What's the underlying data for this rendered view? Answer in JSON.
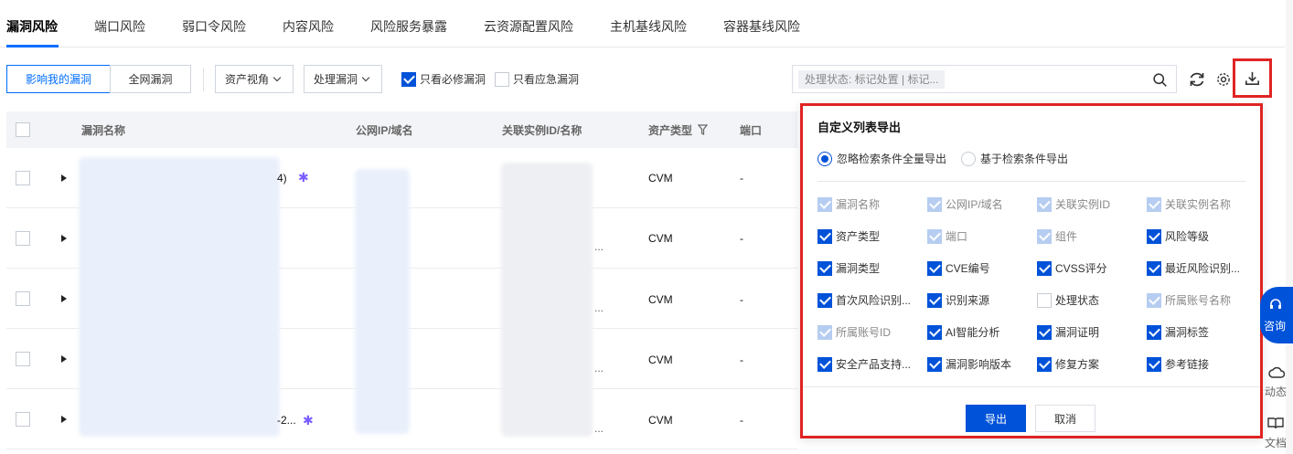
{
  "tabs": [
    "漏洞风险",
    "端口风险",
    "弱口令风险",
    "内容风险",
    "风险服务暴露",
    "云资源配置风险",
    "主机基线风险",
    "容器基线风险"
  ],
  "toolbar": {
    "seg_mine": "影响我的漏洞",
    "seg_all": "全网漏洞",
    "asset_view": "资产视角",
    "handle": "处理漏洞",
    "must_fix": "只看必修漏洞",
    "emergency": "只看应急漏洞",
    "search_tag": "处理状态: 标记处置 | 标记..."
  },
  "table": {
    "headers": {
      "name": "漏洞名称",
      "ip": "公网IP/域名",
      "instance": "关联实例ID/名称",
      "asset": "资产类型",
      "port": "端口"
    },
    "rows": [
      {
        "name_tail": "4)",
        "instance_tail": "",
        "asset": "CVM",
        "port": "-",
        "spark": true
      },
      {
        "name_tail": "",
        "instance_tail": "...",
        "asset": "CVM",
        "port": "-",
        "spark": false
      },
      {
        "name_tail": "",
        "instance_tail": "...",
        "asset": "CVM",
        "port": "-",
        "spark": false
      },
      {
        "name_tail": "",
        "instance_tail": "...",
        "asset": "CVM",
        "port": "-",
        "spark": false
      },
      {
        "name_tail": "-2...",
        "instance_tail": "...",
        "asset": "CVM",
        "port": "-",
        "spark": true
      }
    ]
  },
  "export": {
    "title": "自定义列表导出",
    "radio_all": "忽略检索条件全量导出",
    "radio_filtered": "基于检索条件导出",
    "fields": [
      {
        "label": "漏洞名称",
        "state": "dis"
      },
      {
        "label": "公网IP/域名",
        "state": "dis"
      },
      {
        "label": "关联实例ID",
        "state": "dis"
      },
      {
        "label": "关联实例名称",
        "state": "dis"
      },
      {
        "label": "资产类型",
        "state": "on"
      },
      {
        "label": "端口",
        "state": "dis"
      },
      {
        "label": "组件",
        "state": "dis"
      },
      {
        "label": "风险等级",
        "state": "on"
      },
      {
        "label": "漏洞类型",
        "state": "on"
      },
      {
        "label": "CVE编号",
        "state": "on"
      },
      {
        "label": "CVSS评分",
        "state": "on"
      },
      {
        "label": "最近风险识别...",
        "state": "on"
      },
      {
        "label": "首次风险识别...",
        "state": "on"
      },
      {
        "label": "识别来源",
        "state": "on"
      },
      {
        "label": "处理状态",
        "state": "off"
      },
      {
        "label": "所属账号名称",
        "state": "dis"
      },
      {
        "label": "所属账号ID",
        "state": "dis"
      },
      {
        "label": "AI智能分析",
        "state": "on"
      },
      {
        "label": "漏洞证明",
        "state": "on"
      },
      {
        "label": "漏洞标签",
        "state": "on"
      },
      {
        "label": "安全产品支持...",
        "state": "on"
      },
      {
        "label": "漏洞影响版本",
        "state": "on"
      },
      {
        "label": "修复方案",
        "state": "on"
      },
      {
        "label": "参考链接",
        "state": "on"
      }
    ],
    "export_btn": "导出",
    "cancel_btn": "取消"
  },
  "side": {
    "consult": "咨询",
    "news": "动态",
    "docs": "文档"
  }
}
